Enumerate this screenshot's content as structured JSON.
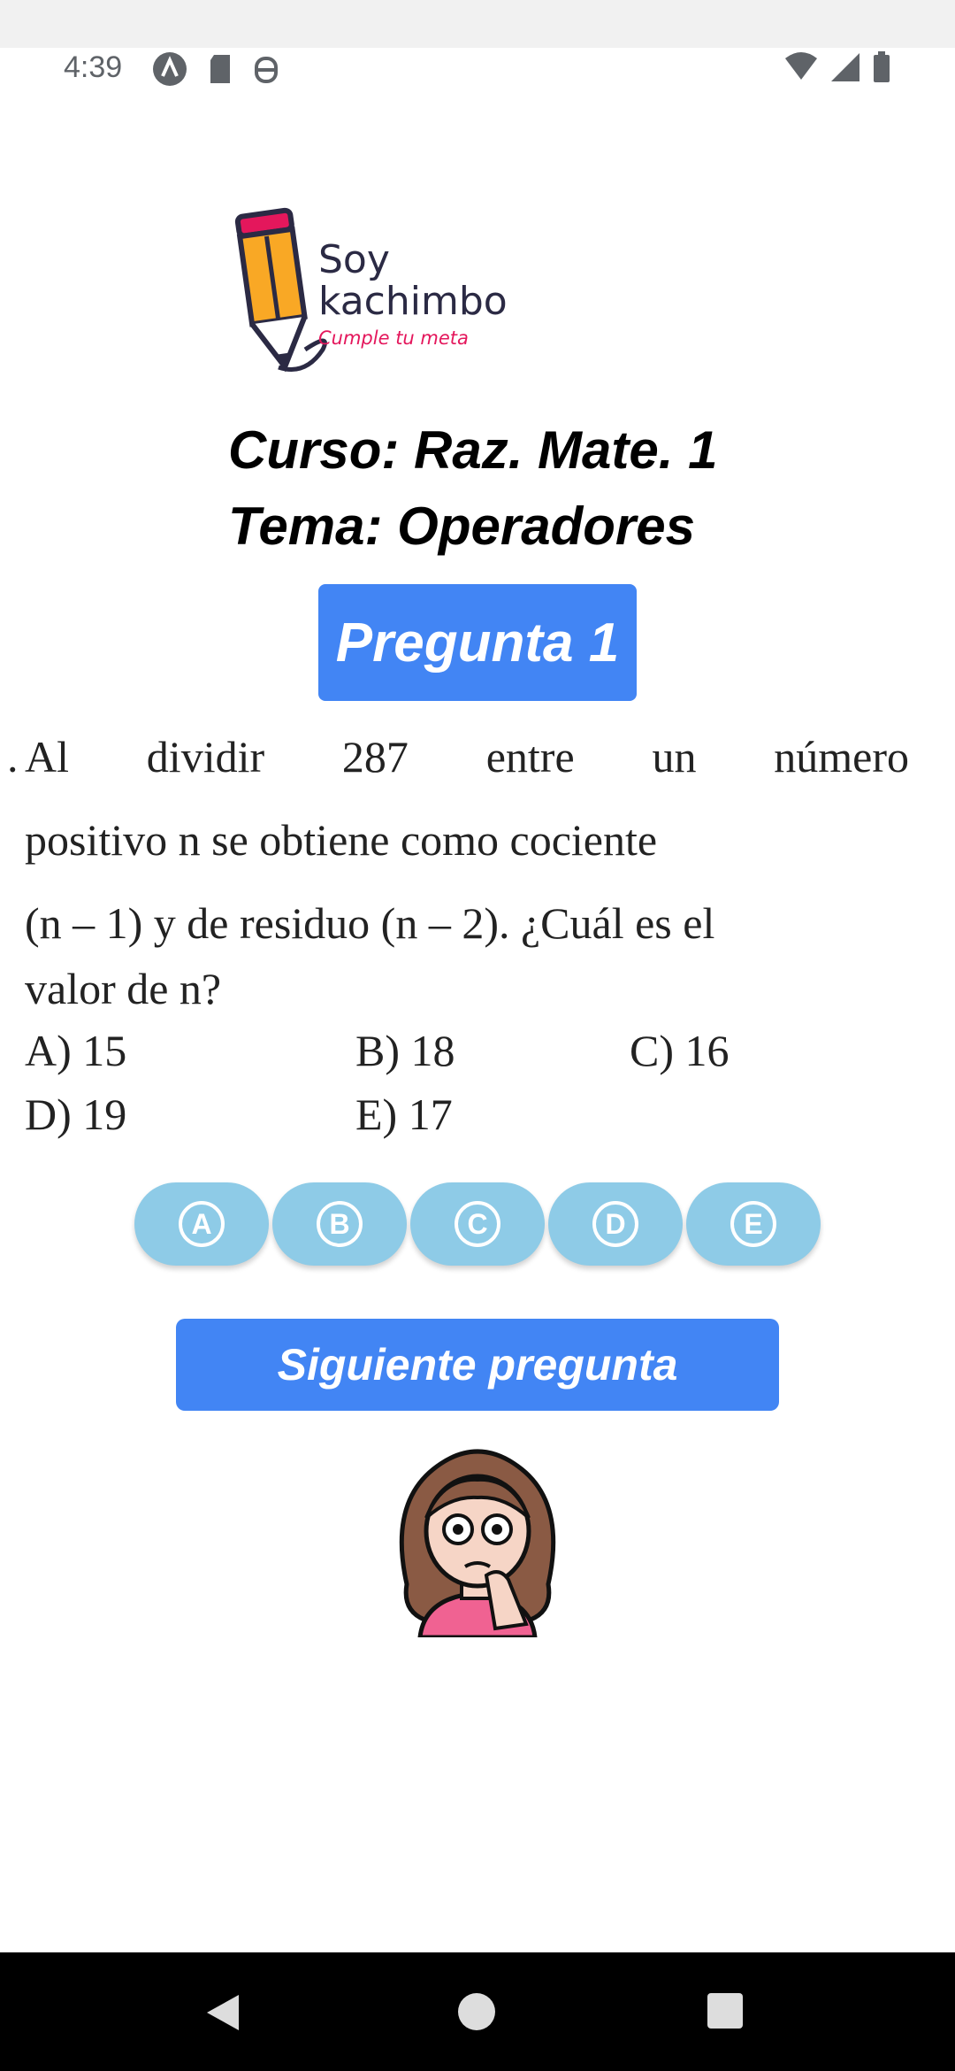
{
  "status_bar": {
    "time": "4:39"
  },
  "logo": {
    "line1": "Soy",
    "line2": "kachimbo",
    "tagline": "Cumple tu meta"
  },
  "header": {
    "course": "Curso: Raz. Mate. 1",
    "topic": "Tema: Operadores"
  },
  "question_badge": "Pregunta 1",
  "question": {
    "line1_words": [
      "Al",
      "dividir",
      "287",
      "entre",
      "un",
      "número"
    ],
    "line2": "positivo n se obtiene como cociente",
    "line3": "(n – 1) y de residuo (n – 2). ¿Cuál es el",
    "line4": "valor de n?",
    "options": {
      "a": "A) 15",
      "b": "B) 18",
      "c": "C) 16",
      "d": "D) 19",
      "e": "E) 17"
    }
  },
  "answer_buttons": [
    "A",
    "B",
    "C",
    "D",
    "E"
  ],
  "next_button": "Siguiente pregunta",
  "colors": {
    "primary": "#4285f4",
    "answer_button": "#8ecbe7",
    "logo_pink": "#e4175c",
    "logo_yellow": "#f9a825"
  }
}
